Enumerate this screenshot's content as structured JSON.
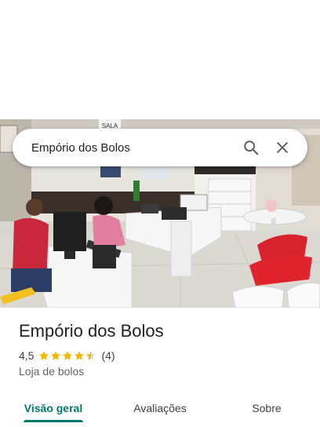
{
  "search": {
    "query": "Empório dos Bolos",
    "search_icon": "search-icon",
    "close_icon": "close-icon"
  },
  "place": {
    "name": "Empório dos Bolos",
    "rating": "4,5",
    "rating_value": 4.5,
    "review_count": "(4)",
    "category": "Loja de bolos",
    "star_color": "#f4b400",
    "photo_sign_text": "SALA"
  },
  "tabs": [
    {
      "label": "Visão geral",
      "active": true
    },
    {
      "label": "Avaliações",
      "active": false
    },
    {
      "label": "Sobre",
      "active": false
    }
  ],
  "colors": {
    "accent": "#00796b",
    "text_primary": "#202124",
    "text_secondary": "#5f6368"
  }
}
